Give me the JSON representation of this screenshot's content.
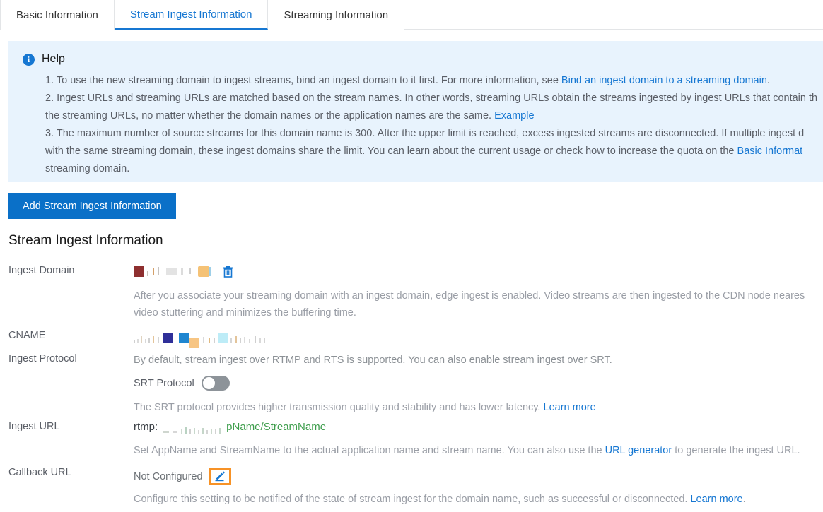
{
  "tabs": [
    {
      "label": "Basic Information",
      "active": false
    },
    {
      "label": "Stream Ingest Information",
      "active": true
    },
    {
      "label": "Streaming Information",
      "active": false
    }
  ],
  "help": {
    "icon": "info-icon",
    "title": "Help",
    "items": [
      {
        "before": "1. To use the new streaming domain to ingest streams, bind an ingest domain to it first. For more information, see ",
        "link": "Bind an ingest domain to a streaming domain",
        "after": "."
      },
      {
        "before": "2. Ingest URLs and streaming URLs are matched based on the stream names. In other words, streaming URLs obtain the streams ingested by ingest URLs that contain th",
        "link": "",
        "after": ""
      },
      {
        "before": "the streaming URLs, no matter whether the domain names or the application names are the same. ",
        "link": "Example",
        "after": ""
      },
      {
        "before": "3. The maximum number of source streams for this domain name is 300. After the upper limit is reached, excess ingested streams are disconnected. If multiple ingest d",
        "link": "",
        "after": ""
      },
      {
        "before": "with the same streaming domain, these ingest domains share the limit. You can learn about the current usage or check how to increase the quota on the ",
        "link": "Basic Informat",
        "after": ""
      },
      {
        "before": "streaming domain.",
        "link": "",
        "after": ""
      }
    ]
  },
  "add_button": {
    "label": "Add Stream Ingest Information"
  },
  "section": {
    "title": "Stream Ingest Information"
  },
  "fields": {
    "ingest_domain": {
      "label": "Ingest Domain",
      "value_redacted": true,
      "delete_icon": "trash-icon",
      "description_line1": "After you associate your streaming domain with an ingest domain, edge ingest is enabled. Video streams are then ingested to the CDN node neares",
      "description_line2": "video stuttering and minimizes the buffering time."
    },
    "cname": {
      "label": "CNAME",
      "value_redacted": true
    },
    "ingest_protocol": {
      "label": "Ingest Protocol",
      "description": "By default, stream ingest over RTMP and RTS is supported. You can also enable stream ingest over SRT.",
      "srt_toggle_label": "SRT Protocol",
      "srt_enabled": false,
      "srt_description": "The SRT protocol provides higher transmission quality and stability and has lower latency. ",
      "srt_link": "Learn more"
    },
    "ingest_url": {
      "label": "Ingest URL",
      "prefix": "rtmp:",
      "suffix": "pName/StreamName",
      "description_before": "Set AppName and StreamName to the actual application name and stream name. You can also use the ",
      "description_link": "URL generator",
      "description_after": " to generate the ingest URL."
    },
    "callback_url": {
      "label": "Callback URL",
      "value": "Not Configured",
      "edit_icon": "pencil-icon",
      "description_before": "Configure this setting to be notified of the state of stream ingest for the domain name, such as successful or disconnected. ",
      "description_link": "Learn more",
      "description_after": "."
    }
  },
  "colors": {
    "accent": "#1677d2",
    "button": "#0a70c8",
    "help_bg": "#e8f3fd",
    "highlight": "#f79226",
    "url_green": "#3f9e4d"
  }
}
